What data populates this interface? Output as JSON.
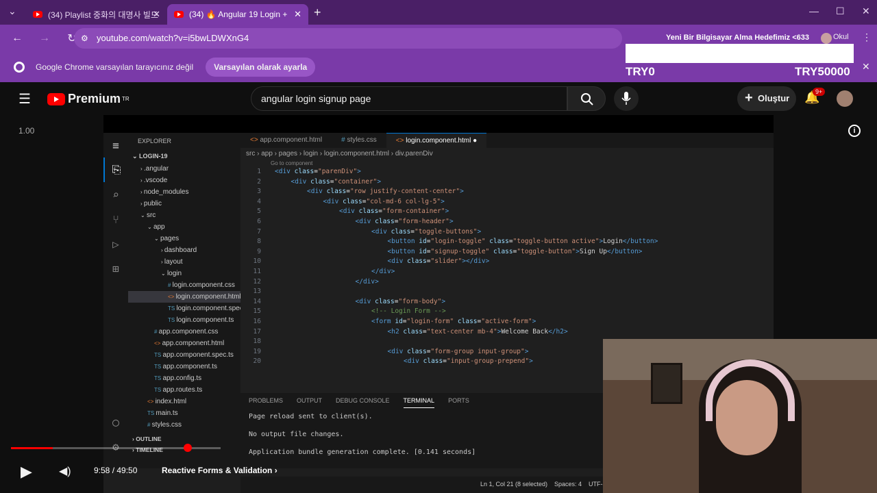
{
  "browser": {
    "tabs": [
      {
        "title": "(34) Playlist 중화의 대명사 빌드"
      },
      {
        "title": "(34) 🔥 Angular 19 Login +"
      }
    ],
    "url": "youtube.com/watch?v=i5bwLDWXnG4",
    "profile": "Okul",
    "notification": {
      "text": "Google Chrome varsayılan tarayıcınız değil",
      "button": "Varsayılan olarak ayarla"
    }
  },
  "stream_overlay": {
    "title": "Yeni Bir Bilgisayar Alma Hedefimiz <633",
    "left": "TRY0",
    "right": "TRY50000"
  },
  "youtube": {
    "brand": "Premium",
    "region": "TR",
    "search_query": "angular login signup page",
    "create_label": "Oluştur",
    "notification_badge": "9+",
    "speed_indicator": "1.00"
  },
  "vscode": {
    "explorer_title": "EXPLORER",
    "project": "LOGIN-19",
    "tree": [
      {
        "label": ".angular",
        "depth": 1,
        "icon": "›"
      },
      {
        "label": ".vscode",
        "depth": 1,
        "icon": "›"
      },
      {
        "label": "node_modules",
        "depth": 1,
        "icon": "›"
      },
      {
        "label": "public",
        "depth": 1,
        "icon": "›"
      },
      {
        "label": "src",
        "depth": 1,
        "icon": "⌄"
      },
      {
        "label": "app",
        "depth": 2,
        "icon": "⌄"
      },
      {
        "label": "pages",
        "depth": 3,
        "icon": "⌄"
      },
      {
        "label": "dashboard",
        "depth": 4,
        "icon": "›"
      },
      {
        "label": "layout",
        "depth": 4,
        "icon": "›"
      },
      {
        "label": "login",
        "depth": 4,
        "icon": "⌄"
      },
      {
        "label": "login.component.css",
        "depth": 5,
        "icon": "#"
      },
      {
        "label": "login.component.html",
        "depth": 5,
        "icon": "<>",
        "selected": true
      },
      {
        "label": "login.component.spec.ts",
        "depth": 5,
        "icon": "TS"
      },
      {
        "label": "login.component.ts",
        "depth": 5,
        "icon": "TS"
      },
      {
        "label": "app.component.css",
        "depth": 3,
        "icon": "#"
      },
      {
        "label": "app.component.html",
        "depth": 3,
        "icon": "<>"
      },
      {
        "label": "app.component.spec.ts",
        "depth": 3,
        "icon": "TS"
      },
      {
        "label": "app.component.ts",
        "depth": 3,
        "icon": "TS"
      },
      {
        "label": "app.config.ts",
        "depth": 3,
        "icon": "TS"
      },
      {
        "label": "app.routes.ts",
        "depth": 3,
        "icon": "TS"
      },
      {
        "label": "index.html",
        "depth": 2,
        "icon": "<>"
      },
      {
        "label": "main.ts",
        "depth": 2,
        "icon": "TS"
      },
      {
        "label": "styles.css",
        "depth": 2,
        "icon": "#"
      }
    ],
    "outline": "OUTLINE",
    "timeline": "TIMELINE",
    "tabs": [
      {
        "label": "app.component.html"
      },
      {
        "label": "styles.css"
      },
      {
        "label": "login.component.html",
        "active": true
      }
    ],
    "breadcrumb": "src › app › pages › login › login.component.html › div.parenDiv",
    "hint": "Go to component",
    "code": [
      {
        "n": "1",
        "indent": 0,
        "html": "<span class='tg'>&lt;div</span> <span class='at'>class</span>=<span class='st'>\"parenDiv\"</span><span class='tg'>&gt;</span>"
      },
      {
        "n": "2",
        "indent": 1,
        "html": "<span class='tg'>&lt;div</span> <span class='at'>class</span>=<span class='st'>\"container\"</span><span class='tg'>&gt;</span>"
      },
      {
        "n": "3",
        "indent": 2,
        "html": "<span class='tg'>&lt;div</span> <span class='at'>class</span>=<span class='st'>\"row justify-content-center\"</span><span class='tg'>&gt;</span>"
      },
      {
        "n": "4",
        "indent": 3,
        "html": "<span class='tg'>&lt;div</span> <span class='at'>class</span>=<span class='st'>\"col-md-6 col-lg-5\"</span><span class='tg'>&gt;</span>"
      },
      {
        "n": "5",
        "indent": 4,
        "html": "<span class='tg'>&lt;div</span> <span class='at'>class</span>=<span class='st'>\"form-container\"</span><span class='tg'>&gt;</span>"
      },
      {
        "n": "6",
        "indent": 5,
        "html": "<span class='tg'>&lt;div</span> <span class='at'>class</span>=<span class='st'>\"form-header\"</span><span class='tg'>&gt;</span>"
      },
      {
        "n": "7",
        "indent": 6,
        "html": "<span class='tg'>&lt;div</span> <span class='at'>class</span>=<span class='st'>\"toggle-buttons\"</span><span class='tg'>&gt;</span>"
      },
      {
        "n": "8",
        "indent": 7,
        "html": "<span class='tg'>&lt;button</span> <span class='at'>id</span>=<span class='st'>\"login-toggle\"</span> <span class='at'>class</span>=<span class='st'>\"toggle-button active\"</span><span class='tg'>&gt;</span><span class='tx'>Login</span><span class='tg'>&lt;/button&gt;</span>"
      },
      {
        "n": "9",
        "indent": 7,
        "html": "<span class='tg'>&lt;button</span> <span class='at'>id</span>=<span class='st'>\"signup-toggle\"</span> <span class='at'>class</span>=<span class='st'>\"toggle-button\"</span><span class='tg'>&gt;</span><span class='tx'>Sign Up</span><span class='tg'>&lt;/button&gt;</span>"
      },
      {
        "n": "10",
        "indent": 7,
        "html": "<span class='tg'>&lt;div</span> <span class='at'>class</span>=<span class='st'>\"slider\"</span><span class='tg'>&gt;&lt;/div&gt;</span>"
      },
      {
        "n": "11",
        "indent": 6,
        "html": "<span class='tg'>&lt;/div&gt;</span>"
      },
      {
        "n": "12",
        "indent": 5,
        "html": "<span class='tg'>&lt;/div&gt;</span>"
      },
      {
        "n": "13",
        "indent": 0,
        "html": ""
      },
      {
        "n": "14",
        "indent": 5,
        "html": "<span class='tg'>&lt;div</span> <span class='at'>class</span>=<span class='st'>\"form-body\"</span><span class='tg'>&gt;</span>"
      },
      {
        "n": "15",
        "indent": 6,
        "html": "<span class='cm'>&lt;!-- Login Form --&gt;</span>"
      },
      {
        "n": "16",
        "indent": 6,
        "html": "<span class='tg'>&lt;form</span> <span class='at'>id</span>=<span class='st'>\"login-form\"</span> <span class='at'>class</span>=<span class='st'>\"active-form\"</span><span class='tg'>&gt;</span>"
      },
      {
        "n": "17",
        "indent": 7,
        "html": "<span class='tg'>&lt;h2</span> <span class='at'>class</span>=<span class='st'>\"text-center mb-4\"</span><span class='tg'>&gt;</span><span class='tx'>Welcome Back</span><span class='tg'>&lt;/h2&gt;</span>"
      },
      {
        "n": "18",
        "indent": 0,
        "html": ""
      },
      {
        "n": "19",
        "indent": 7,
        "html": "<span class='tg'>&lt;div</span> <span class='at'>class</span>=<span class='st'>\"form-group input-group\"</span><span class='tg'>&gt;</span>"
      },
      {
        "n": "20",
        "indent": 8,
        "html": "<span class='tg'>&lt;div</span> <span class='at'>class</span>=<span class='st'>\"input-group-prepend\"</span><span class='tg'>&gt;</span>"
      }
    ],
    "panel_tabs": [
      "PROBLEMS",
      "OUTPUT",
      "DEBUG CONSOLE",
      "TERMINAL",
      "PORTS"
    ],
    "terminal": [
      "Page reload sent to client(s).",
      "No output file changes.",
      "Application bundle generation complete. [0.141 seconds]"
    ],
    "status": {
      "position": "Ln 1, Col 21 (8 selected)",
      "spaces": "Spaces: 4",
      "encoding": "UTF-8"
    }
  },
  "player": {
    "time": "9:58 / 49:50",
    "chapter": "Reactive Forms & Validation",
    "progress": 0.2
  }
}
